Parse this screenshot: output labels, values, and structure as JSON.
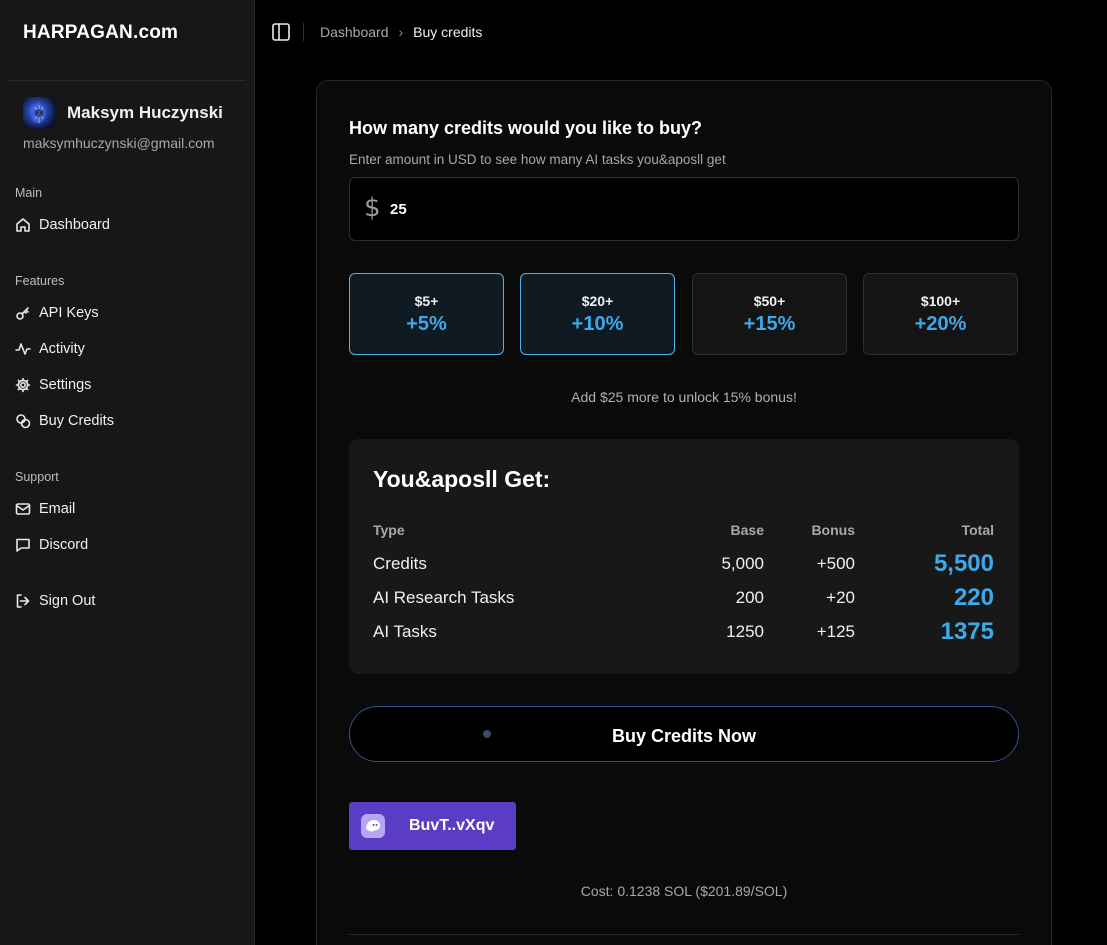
{
  "brand": "HARPAGAN.com",
  "user": {
    "name": "Maksym Huczynski",
    "email": "maksymhuczynski@gmail.com"
  },
  "sidebar": {
    "groups": [
      {
        "label": "Main",
        "items": [
          {
            "label": "Dashboard",
            "icon": "home-icon"
          }
        ]
      },
      {
        "label": "Features",
        "items": [
          {
            "label": "API Keys",
            "icon": "key-icon"
          },
          {
            "label": "Activity",
            "icon": "activity-icon"
          },
          {
            "label": "Settings",
            "icon": "gear-icon"
          },
          {
            "label": "Buy Credits",
            "icon": "coins-icon"
          }
        ]
      },
      {
        "label": "Support",
        "items": [
          {
            "label": "Email",
            "icon": "mail-icon"
          },
          {
            "label": "Discord",
            "icon": "chat-icon"
          }
        ]
      }
    ],
    "signout": {
      "label": "Sign Out",
      "icon": "logout-icon"
    }
  },
  "breadcrumb": {
    "parent": "Dashboard",
    "separator": "›",
    "current": "Buy credits"
  },
  "purchase": {
    "title": "How many credits would you like to buy?",
    "subtitle": "Enter amount in USD to see how many AI tasks you&aposll get",
    "currency_symbol": "$",
    "amount": "25",
    "tiers": [
      {
        "min": "$5+",
        "bonus": "+5%",
        "active": true
      },
      {
        "min": "$20+",
        "bonus": "+10%",
        "active": true
      },
      {
        "min": "$50+",
        "bonus": "+15%",
        "active": false
      },
      {
        "min": "$100+",
        "bonus": "+20%",
        "active": false
      }
    ],
    "unlock_note": "Add $25 more to unlock 15% bonus!"
  },
  "summary": {
    "title": "You&aposll Get:",
    "headers": {
      "type": "Type",
      "base": "Base",
      "bonus": "Bonus",
      "total": "Total"
    },
    "rows": [
      {
        "type": "Credits",
        "base": "5,000",
        "bonus": "+500",
        "total": "5,500"
      },
      {
        "type": "AI Research Tasks",
        "base": "200",
        "bonus": "+20",
        "total": "220"
      },
      {
        "type": "AI Tasks",
        "base": "1250",
        "bonus": "+125",
        "total": "1375"
      }
    ]
  },
  "buy_button": {
    "label": "Buy Credits Now"
  },
  "wallet": {
    "label": "BuvT..vXqv",
    "icon": "phantom-wallet-icon"
  },
  "cost_note": "Cost: 0.1238 SOL ($201.89/SOL)",
  "colors": {
    "accent": "#3fa9e8",
    "wallet": "#5b3cc4",
    "sidebar_bg": "#171717"
  }
}
